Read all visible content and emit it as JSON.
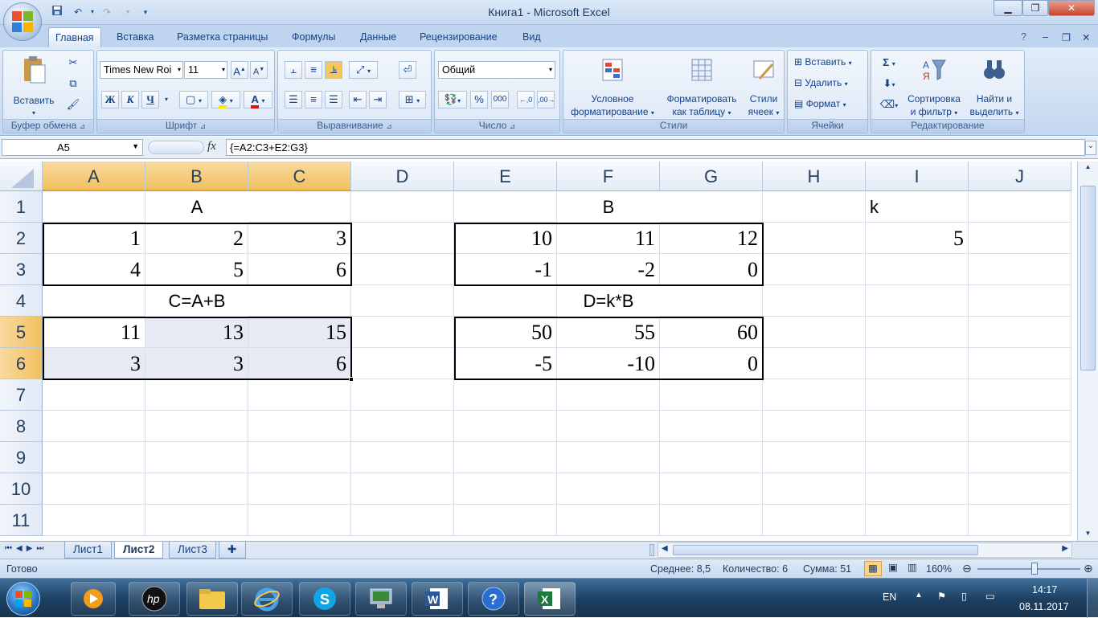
{
  "window": {
    "title": "Книга1 - Microsoft Excel"
  },
  "quick_access": {
    "save": "save-icon",
    "undo": "undo-icon",
    "redo": "redo-icon"
  },
  "tabs": [
    "Главная",
    "Вставка",
    "Разметка страницы",
    "Формулы",
    "Данные",
    "Рецензирование",
    "Вид"
  ],
  "ribbon": {
    "clipboard": {
      "paste": "Вставить",
      "label": "Буфер обмена"
    },
    "font": {
      "name": "Times New Roi",
      "size": "11",
      "bold": "Ж",
      "italic": "К",
      "underline": "Ч",
      "label": "Шрифт"
    },
    "alignment": {
      "label": "Выравнивание"
    },
    "number": {
      "format": "Общий",
      "label": "Число"
    },
    "styles": {
      "cond_line1": "Условное",
      "cond_line2": "форматирование",
      "table_line1": "Форматировать",
      "table_line2": "как таблицу",
      "cell_line1": "Стили",
      "cell_line2": "ячеек",
      "label": "Стили"
    },
    "cells": {
      "insert": "Вставить",
      "delete": "Удалить",
      "format": "Формат",
      "label": "Ячейки"
    },
    "editing": {
      "sort_line1": "Сортировка",
      "sort_line2": "и фильтр",
      "find_line1": "Найти и",
      "find_line2": "выделить",
      "label": "Редактирование"
    }
  },
  "formula_bar": {
    "name_box": "A5",
    "fx": "fx",
    "formula": "{=A2:C3+E2:G3}"
  },
  "columns": [
    "A",
    "B",
    "C",
    "D",
    "E",
    "F",
    "G",
    "H",
    "I",
    "J"
  ],
  "rows": [
    "1",
    "2",
    "3",
    "4",
    "5",
    "6",
    "7",
    "8",
    "9",
    "10",
    "11"
  ],
  "cells": {
    "B1": "A",
    "F1": "B",
    "I1": "k",
    "A2": "1",
    "B2": "2",
    "C2": "3",
    "E2": "10",
    "F2": "11",
    "G2": "12",
    "I2": "5",
    "A3": "4",
    "B3": "5",
    "C3": "6",
    "E3": "-1",
    "F3": "-2",
    "G3": "0",
    "B4": "C=A+B",
    "F4": "D=k*B",
    "A5": "11",
    "B5": "13",
    "C5": "15",
    "E5": "50",
    "F5": "55",
    "G5": "60",
    "A6": "3",
    "B6": "3",
    "C6": "6",
    "E6": "-5",
    "F6": "-10",
    "G6": "0"
  },
  "sheets": [
    "Лист1",
    "Лист2",
    "Лист3"
  ],
  "active_sheet": "Лист2",
  "status": {
    "ready": "Готово",
    "average": "Среднее: 8,5",
    "count": "Количество: 6",
    "sum": "Сумма: 51",
    "zoom": "160%"
  },
  "taskbar": {
    "lang": "EN",
    "time": "14:17",
    "date": "08.11.2017"
  },
  "colors": {
    "selected_header": "#f1c15f",
    "ribbon": "#dde8f6",
    "taskbar": "#1c3f62"
  }
}
